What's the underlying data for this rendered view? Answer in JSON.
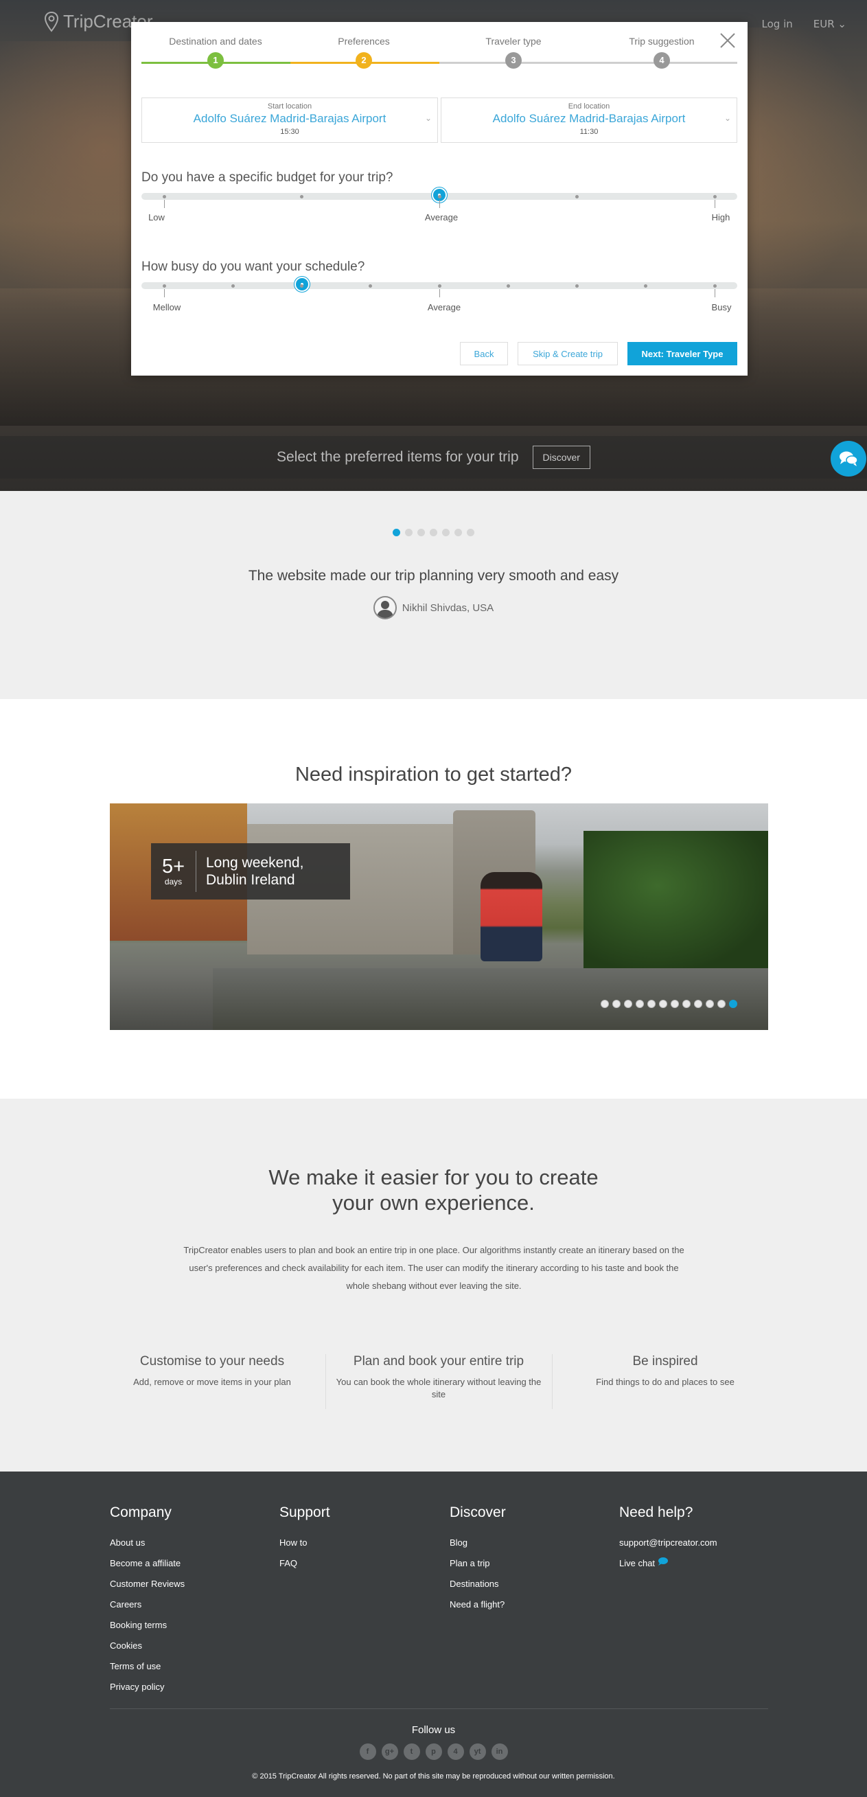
{
  "header": {
    "logo_text": "TripCreator",
    "login_label": "Log in",
    "currency_label": "EUR"
  },
  "modal": {
    "steps": [
      {
        "label": "Destination and dates",
        "number": "1",
        "color": "#7cbf3f"
      },
      {
        "label": "Preferences",
        "number": "2",
        "color": "#f1b21d"
      },
      {
        "label": "Traveler type",
        "number": "3",
        "color": "#999999"
      },
      {
        "label": "Trip suggestion",
        "number": "4",
        "color": "#999999"
      }
    ],
    "start": {
      "title": "Start location",
      "value": "Adolfo Suárez Madrid-Barajas Airport",
      "time": "15:30"
    },
    "end": {
      "title": "End location",
      "value": "Adolfo Suárez Madrid-Barajas Airport",
      "time": "11:30"
    },
    "budget": {
      "question": "Do you have a specific budget for your trip?",
      "labels": [
        "Low",
        "Average",
        "High"
      ],
      "level": 0.5
    },
    "schedule": {
      "question": "How busy do you want your schedule?",
      "labels": [
        "Mellow",
        "Average",
        "Busy"
      ],
      "level": 0.25
    },
    "back_label": "Back",
    "skip_label": "Skip & Create trip",
    "next_label": "Next: Traveler Type"
  },
  "discover_bar": {
    "text": "Select the preferred items for your trip",
    "button": "Discover"
  },
  "testimonial": {
    "quote": "The website made our trip planning very smooth and easy",
    "author": "Nikhil Shivdas, USA"
  },
  "inspiration": {
    "title": "Need inspiration to get started?",
    "days_number": "5+",
    "days_label": "days",
    "caption_line1": "Long weekend,",
    "caption_line2": "Dublin Ireland"
  },
  "easier": {
    "title_line1": "We make it easier for you to create",
    "title_line2": "your own experience.",
    "body": "TripCreator enables users to plan and book an entire trip in one place. Our algorithms instantly create an itinerary based on the user's preferences and check availability for each item. The user can modify the itinerary according to his taste and book the whole shebang without ever leaving the site.",
    "features": [
      {
        "title": "Customise to your needs",
        "desc": "Add, remove or move items in your plan"
      },
      {
        "title": "Plan and book your entire trip",
        "desc": "You can book the whole itinerary without leaving the site"
      },
      {
        "title": "Be inspired",
        "desc": "Find things to do and places to see"
      }
    ]
  },
  "footer": {
    "company": {
      "title": "Company",
      "links": [
        "About us",
        "Become a affiliate",
        "Customer Reviews",
        "Careers",
        "Booking terms",
        "Cookies",
        "Terms of use",
        "Privacy policy"
      ]
    },
    "support": {
      "title": "Support",
      "links": [
        "How to",
        "FAQ"
      ]
    },
    "discover": {
      "title": "Discover",
      "links": [
        "Blog",
        "Plan a trip",
        "Destinations",
        "Need a flight?"
      ]
    },
    "help": {
      "title": "Need help?",
      "email": "support@tripcreator.com",
      "chat": "Live chat"
    },
    "follow": "Follow us",
    "social": [
      "f",
      "g+",
      "t",
      "p",
      "4",
      "yt",
      "in"
    ],
    "copyright": "© 2015 TripCreator All rights reserved. No part of this site may be reproduced without our written permission."
  },
  "colors": {
    "accent": "#11a3d9",
    "green": "#7cbf3f",
    "orange": "#f1b21d",
    "footer_bg": "#3b3e40"
  }
}
